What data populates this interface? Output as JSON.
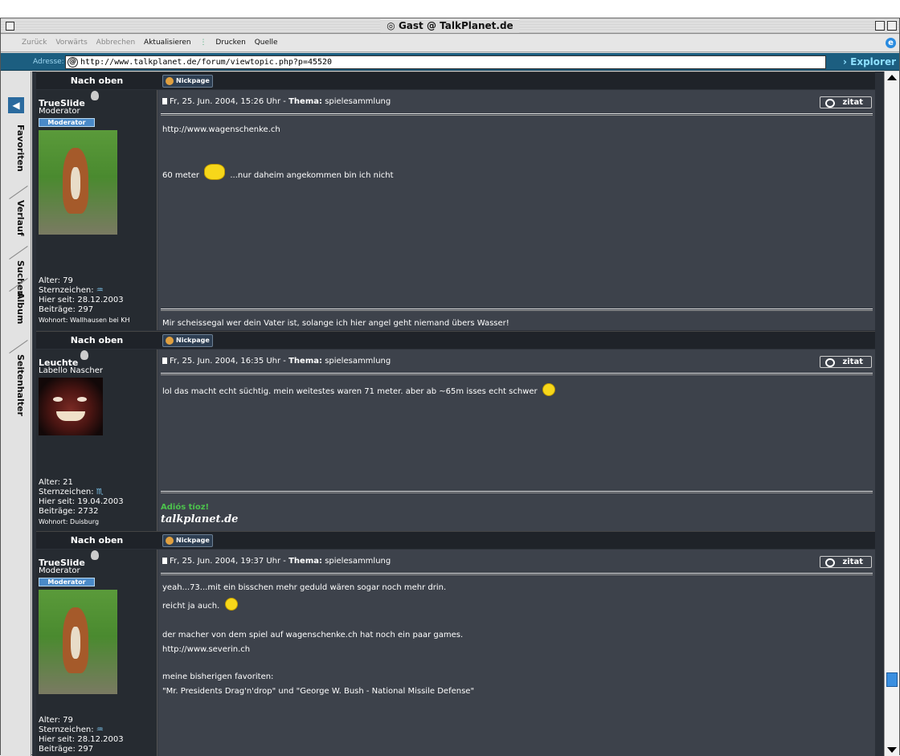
{
  "window": {
    "title": "Gast @ TalkPlanet.de"
  },
  "toolbar": {
    "back": "Zurück",
    "forward": "Vorwärts",
    "stop": "Abbrechen",
    "refresh": "Aktualisieren",
    "print": "Drucken",
    "source": "Quelle"
  },
  "address": {
    "label": "Adresse:",
    "url": "http://www.talkplanet.de/forum/viewtopic.php?p=45520",
    "go": "Explorer"
  },
  "sidebar": {
    "tabs": [
      {
        "label": "Favoriten"
      },
      {
        "label": "Verlauf"
      },
      {
        "label": "Suchen"
      },
      {
        "label": "Album"
      },
      {
        "label": "Seitenhalter"
      }
    ]
  },
  "nav": {
    "back_to_top": "Nach oben",
    "nickpage": "Nickpage"
  },
  "labels": {
    "thema": "Thema:",
    "zitat": "zitat",
    "moderator_badge": "Moderator"
  },
  "posts": [
    {
      "author": "TrueSlide",
      "rank": "Moderator",
      "age": "Alter: 79",
      "zodiac_label": "Sternzeichen:",
      "zodiac_symbol": "♒",
      "since": "Hier seit: 28.12.2003",
      "posts_count": "Beiträge: 297",
      "location": "Wohnort: Wallhausen bei KH",
      "date": "Fr, 25. Jun. 2004, 15:26 Uhr -",
      "topic": "spielesammlung",
      "lines": [
        "http://www.wagenschenke.ch",
        "60 meter",
        "...nur daheim angekommen bin ich nicht"
      ],
      "signature": "Mir scheissegal wer dein Vater ist, solange ich hier angel geht niemand übers Wasser!"
    },
    {
      "author": "Leuchte",
      "rank": "Labello Nascher",
      "age": "Alter: 21",
      "zodiac_label": "Sternzeichen:",
      "zodiac_symbol": "♏",
      "since": "Hier seit: 19.04.2003",
      "posts_count": "Beiträge: 2732",
      "location": "Wohnort: Duisburg",
      "date": "Fr, 25. Jun. 2004, 16:35 Uhr -",
      "topic": "spielesammlung",
      "lines": [
        "lol das macht echt süchtig. mein weitestes waren 71 meter. aber ab ~65m isses echt schwer"
      ],
      "signature": "Adiós tíoz!",
      "signature_logo": "talkplanet.de"
    },
    {
      "author": "TrueSlide",
      "rank": "Moderator",
      "age": "Alter: 79",
      "zodiac_label": "Sternzeichen:",
      "zodiac_symbol": "♒",
      "since": "Hier seit: 28.12.2003",
      "posts_count": "Beiträge: 297",
      "date": "Fr, 25. Jun. 2004, 19:37 Uhr -",
      "topic": "spielesammlung",
      "lines": [
        "yeah...73...mit ein bisschen mehr geduld wären sogar noch mehr drin.",
        "reicht ja auch.",
        "der macher von dem spiel auf wagenschenke.ch hat noch ein paar games.",
        "http://www.severin.ch",
        "meine bisherigen favoriten:",
        "\"Mr. Presidents Drag'n'drop\" und \"George W. Bush - National Missile Defense\""
      ]
    }
  ]
}
